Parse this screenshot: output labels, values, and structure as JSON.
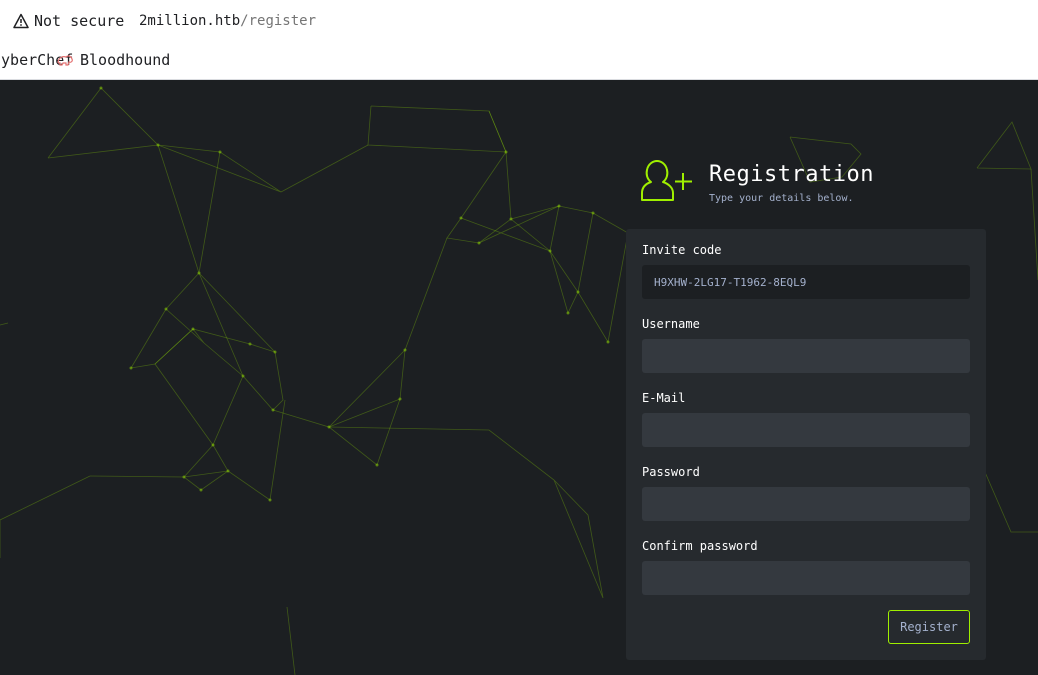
{
  "browser": {
    "security_label": "Not secure",
    "url_host": "2million.htb",
    "url_path": "/register",
    "bookmarks": [
      {
        "label": "CyberChef"
      },
      {
        "label": "Bloodhound"
      }
    ]
  },
  "colors": {
    "accent": "#9fef00",
    "background": "#1c1f22",
    "card": "#262a2e",
    "input": "#34393f",
    "muted_text": "#a4b1cd"
  },
  "header": {
    "icon": "add-user-icon",
    "title": "Registration",
    "subtitle": "Type your details below."
  },
  "form": {
    "invite_code": {
      "label": "Invite code",
      "value": "H9XHW-2LG17-T1962-8EQL9"
    },
    "username": {
      "label": "Username",
      "value": ""
    },
    "email": {
      "label": "E-Mail",
      "value": ""
    },
    "password": {
      "label": "Password",
      "value": ""
    },
    "confirm_password": {
      "label": "Confirm password",
      "value": ""
    },
    "submit_label": "Register"
  }
}
